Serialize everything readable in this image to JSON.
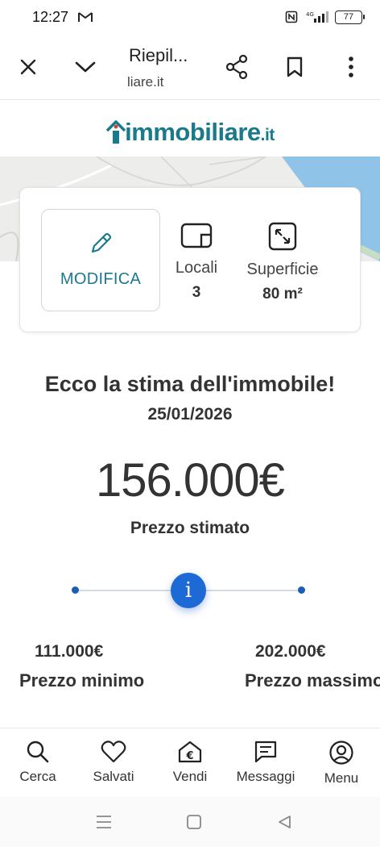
{
  "status_bar": {
    "time": "12:27",
    "battery": "77",
    "network": "4G"
  },
  "browser": {
    "title": "Riepil...",
    "url": "liare.it"
  },
  "logo": {
    "main": "immobiliare",
    "tld": ".it"
  },
  "card": {
    "edit_label": "MODIFICA",
    "rooms_label": "Locali",
    "rooms_value": "3",
    "area_label": "Superficie",
    "area_value": "80 m²"
  },
  "estimate": {
    "title": "Ecco la stima dell'immobile!",
    "date": "25/01/2026",
    "price": "156.000€",
    "price_caption": "Prezzo stimato",
    "min_value": "111.000€",
    "min_label": "Prezzo minimo",
    "max_value": "202.000€",
    "max_label": "Prezzo massimo",
    "info_glyph": "i"
  },
  "bottom_nav": [
    {
      "label": "Cerca",
      "icon": "search-icon"
    },
    {
      "label": "Salvati",
      "icon": "heart-icon"
    },
    {
      "label": "Vendi",
      "icon": "euro-house-icon"
    },
    {
      "label": "Messaggi",
      "icon": "message-icon"
    },
    {
      "label": "Menu",
      "icon": "user-circle-icon"
    }
  ],
  "colors": {
    "brand": "#1a7a8c",
    "accent": "#1d6ad6"
  }
}
